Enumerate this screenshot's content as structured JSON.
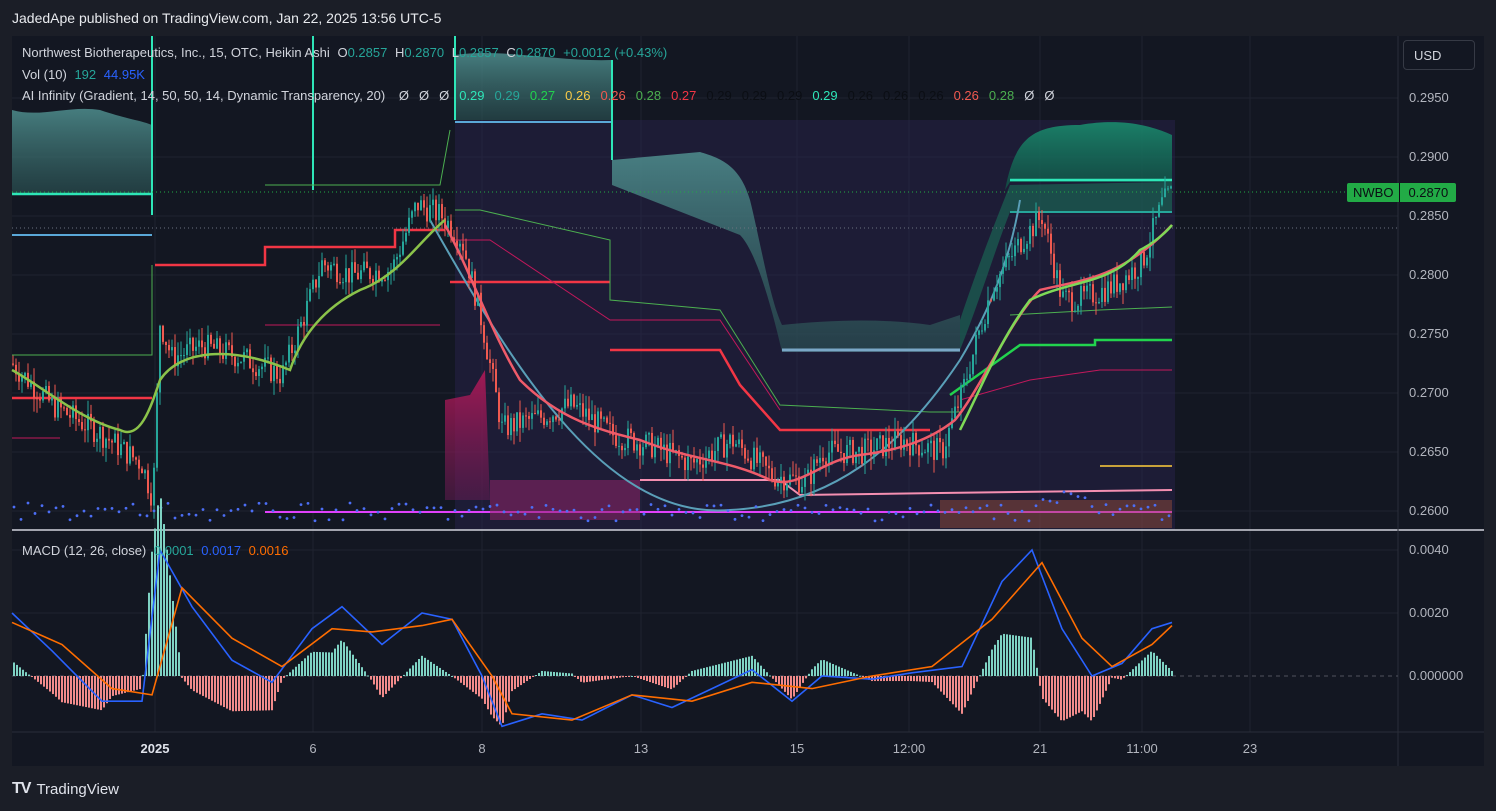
{
  "header": {
    "published": "JadedApe published on TradingView.com, Jan 22, 2025 13:56 UTC-5"
  },
  "legend": {
    "line1_title": "Northwest Biotherapeutics, Inc., 15, OTC, Heikin Ashi",
    "o_label": "O",
    "o_value": "0.2857",
    "h_label": "H",
    "h_value": "0.2870",
    "l_label": "L",
    "l_value": "0.2857",
    "c_label": "C",
    "c_value": "0.2870",
    "change": "+0.0012 (+0.43%)",
    "vol_label": "Vol (10)",
    "vol_value1": "192",
    "vol_value2": "44.95K",
    "ai_label": "AI Infinity (Gradient, 14, 50, 50, 14, Dynamic Transparency, 20)",
    "ai_values": [
      {
        "t": "Ø",
        "c": "#d1d4dc"
      },
      {
        "t": "Ø",
        "c": "#d1d4dc"
      },
      {
        "t": "Ø",
        "c": "#d1d4dc"
      },
      {
        "t": "0.29",
        "c": "#2ee6b8"
      },
      {
        "t": "0.29",
        "c": "#26a69a"
      },
      {
        "t": "0.27",
        "c": "#22d34e"
      },
      {
        "t": "0.26",
        "c": "#f7c948"
      },
      {
        "t": "0.26",
        "c": "#f05a50"
      },
      {
        "t": "0.28",
        "c": "#4caf50"
      },
      {
        "t": "0.27",
        "c": "#f23645"
      },
      {
        "t": "0.29",
        "c": "#0b0e14"
      },
      {
        "t": "0.29",
        "c": "#0b0e14"
      },
      {
        "t": "0.29",
        "c": "#0b0e14"
      },
      {
        "t": "0.29",
        "c": "#2ee6b8"
      },
      {
        "t": "0.26",
        "c": "#0b0e14"
      },
      {
        "t": "0.26",
        "c": "#0b0e14"
      },
      {
        "t": "0.26",
        "c": "#0b0e14"
      },
      {
        "t": "0.26",
        "c": "#f05a50"
      },
      {
        "t": "0.28",
        "c": "#4caf50"
      },
      {
        "t": "Ø",
        "c": "#d1d4dc"
      },
      {
        "t": "Ø",
        "c": "#d1d4dc"
      }
    ],
    "macd_label": "MACD (12, 26, close)",
    "macd_hist": "0.0001",
    "macd_line": "0.0017",
    "macd_signal": "0.0016"
  },
  "toolbar": {
    "currency": "USD"
  },
  "price_tag": {
    "symbol": "NWBO",
    "value": "0.2870"
  },
  "footer": {
    "brand": "TradingView",
    "logo": "TV"
  },
  "colors": {
    "up": "#26a69a",
    "down": "#f05a50",
    "macd": "#2962ff",
    "signal": "#ff6d00",
    "accent": "#22ab46",
    "cloud": "#3b6f6f"
  },
  "chart_data": [
    {
      "type": "candlestick",
      "title": "Northwest Biotherapeutics, Inc., 15, OTC, Heikin Ashi",
      "y_ticks": [
        "0.2950",
        "0.2900",
        "0.2850",
        "0.2800",
        "0.2750",
        "0.2700",
        "0.2650",
        "0.2600"
      ],
      "x_ticks": [
        "2025",
        "6",
        "8",
        "13",
        "15",
        "12:00",
        "21",
        "11:00",
        "23"
      ],
      "ylim": [
        0.259,
        0.2985
      ],
      "last_price": 0.287,
      "price_path": [
        [
          0,
          0.2725
        ],
        [
          40,
          0.269
        ],
        [
          90,
          0.2665
        ],
        [
          130,
          0.264
        ],
        [
          141,
          0.261
        ],
        [
          148,
          0.276
        ],
        [
          160,
          0.273
        ],
        [
          190,
          0.274
        ],
        [
          230,
          0.273
        ],
        [
          270,
          0.2715
        ],
        [
          290,
          0.276
        ],
        [
          310,
          0.281
        ],
        [
          340,
          0.28
        ],
        [
          380,
          0.2805
        ],
        [
          405,
          0.286
        ],
        [
          430,
          0.285
        ],
        [
          450,
          0.283
        ],
        [
          470,
          0.276
        ],
        [
          490,
          0.267
        ],
        [
          530,
          0.268
        ],
        [
          560,
          0.269
        ],
        [
          600,
          0.2665
        ],
        [
          640,
          0.2655
        ],
        [
          680,
          0.264
        ],
        [
          720,
          0.266
        ],
        [
          760,
          0.263
        ],
        [
          795,
          0.2625
        ],
        [
          810,
          0.265
        ],
        [
          850,
          0.265
        ],
        [
          890,
          0.266
        ],
        [
          930,
          0.265
        ],
        [
          950,
          0.27
        ],
        [
          980,
          0.279
        ],
        [
          1010,
          0.283
        ],
        [
          1030,
          0.285
        ],
        [
          1050,
          0.278
        ],
        [
          1070,
          0.278
        ],
        [
          1100,
          0.279
        ],
        [
          1130,
          0.281
        ],
        [
          1150,
          0.286
        ],
        [
          1160,
          0.287
        ]
      ]
    },
    {
      "type": "line",
      "title": "MACD (12, 26, close)",
      "y_ticks": [
        "0.0040",
        "0.0020",
        "0.000000"
      ],
      "ylim": [
        -0.0018,
        0.0042
      ],
      "series": [
        {
          "name": "MACD",
          "values": [
            [
              0,
              0.002
            ],
            [
              40,
              0.0008
            ],
            [
              90,
              -0.0008
            ],
            [
              130,
              -0.0008
            ],
            [
              148,
              0.004
            ],
            [
              180,
              0.0022
            ],
            [
              220,
              0.0005
            ],
            [
              260,
              -0.0002
            ],
            [
              300,
              0.0015
            ],
            [
              330,
              0.0022
            ],
            [
              370,
              0.001
            ],
            [
              410,
              0.002
            ],
            [
              440,
              0.0018
            ],
            [
              470,
              0.0
            ],
            [
              490,
              -0.0016
            ],
            [
              530,
              -0.0012
            ],
            [
              570,
              -0.0014
            ],
            [
              620,
              -0.0006
            ],
            [
              660,
              -0.001
            ],
            [
              700,
              -0.0004
            ],
            [
              740,
              0.0002
            ],
            [
              780,
              -0.0008
            ],
            [
              810,
              0.0
            ],
            [
              860,
              -0.0001
            ],
            [
              900,
              0.0001
            ],
            [
              950,
              0.0003
            ],
            [
              990,
              0.003
            ],
            [
              1020,
              0.004
            ],
            [
              1050,
              0.0015
            ],
            [
              1080,
              0.0
            ],
            [
              1110,
              0.0004
            ],
            [
              1140,
              0.0015
            ],
            [
              1160,
              0.0017
            ]
          ]
        },
        {
          "name": "Signal",
          "values": [
            [
              0,
              0.0017
            ],
            [
              50,
              0.001
            ],
            [
              100,
              -0.0004
            ],
            [
              140,
              -0.0006
            ],
            [
              170,
              0.0028
            ],
            [
              220,
              0.0012
            ],
            [
              270,
              0.0003
            ],
            [
              320,
              0.0015
            ],
            [
              360,
              0.0014
            ],
            [
              410,
              0.0016
            ],
            [
              440,
              0.0018
            ],
            [
              480,
              0.0
            ],
            [
              500,
              -0.0012
            ],
            [
              560,
              -0.0014
            ],
            [
              620,
              -0.0006
            ],
            [
              680,
              -0.0008
            ],
            [
              740,
              -0.0002
            ],
            [
              800,
              -0.0004
            ],
            [
              860,
              0.0
            ],
            [
              920,
              0.0003
            ],
            [
              980,
              0.0018
            ],
            [
              1030,
              0.0036
            ],
            [
              1070,
              0.0012
            ],
            [
              1100,
              0.0003
            ],
            [
              1140,
              0.001
            ],
            [
              1160,
              0.0016
            ]
          ]
        }
      ]
    }
  ]
}
